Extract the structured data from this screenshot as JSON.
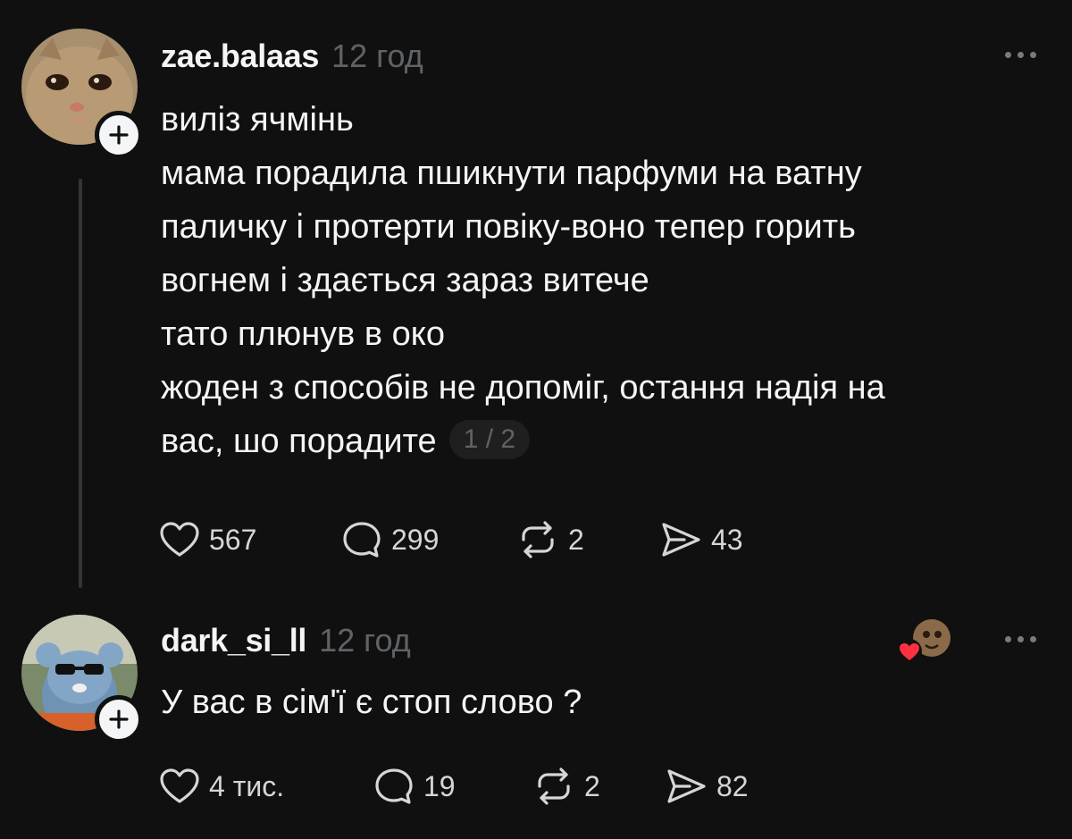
{
  "posts": [
    {
      "username": "zae.balaas",
      "time": "12 год",
      "lines": [
        "виліз ячмінь",
        "мама порадила пшикнути парфуми на ватну",
        "паличку і протерти повіку-воно тепер горить",
        "вогнем і здається зараз витече",
        "тато плюнув в око",
        "жоден з способів не допоміг, остання надія на",
        "вас, шо порадите"
      ],
      "page_indicator": "1 / 2",
      "likes": "567",
      "comments": "299",
      "reposts": "2",
      "shares": "43"
    },
    {
      "username": "dark_si_ll",
      "time": "12 год",
      "text": "У вас в сім'ї є стоп слово ?",
      "likes": "4 тис.",
      "comments": "19",
      "reposts": "2",
      "shares": "82"
    }
  ],
  "icons": {
    "like": "heart-icon",
    "comment": "comment-bubble-icon",
    "repost": "repost-icon",
    "share": "send-icon",
    "more": "more-horizontal-icon",
    "follow": "plus-icon",
    "liked_by_author": "heart-badge-icon"
  },
  "colors": {
    "background": "#101010",
    "primary_text": "#f3f5f7",
    "secondary_text": "#5f6367",
    "thread_line": "#333638",
    "heart_badge": "#ff3040"
  }
}
